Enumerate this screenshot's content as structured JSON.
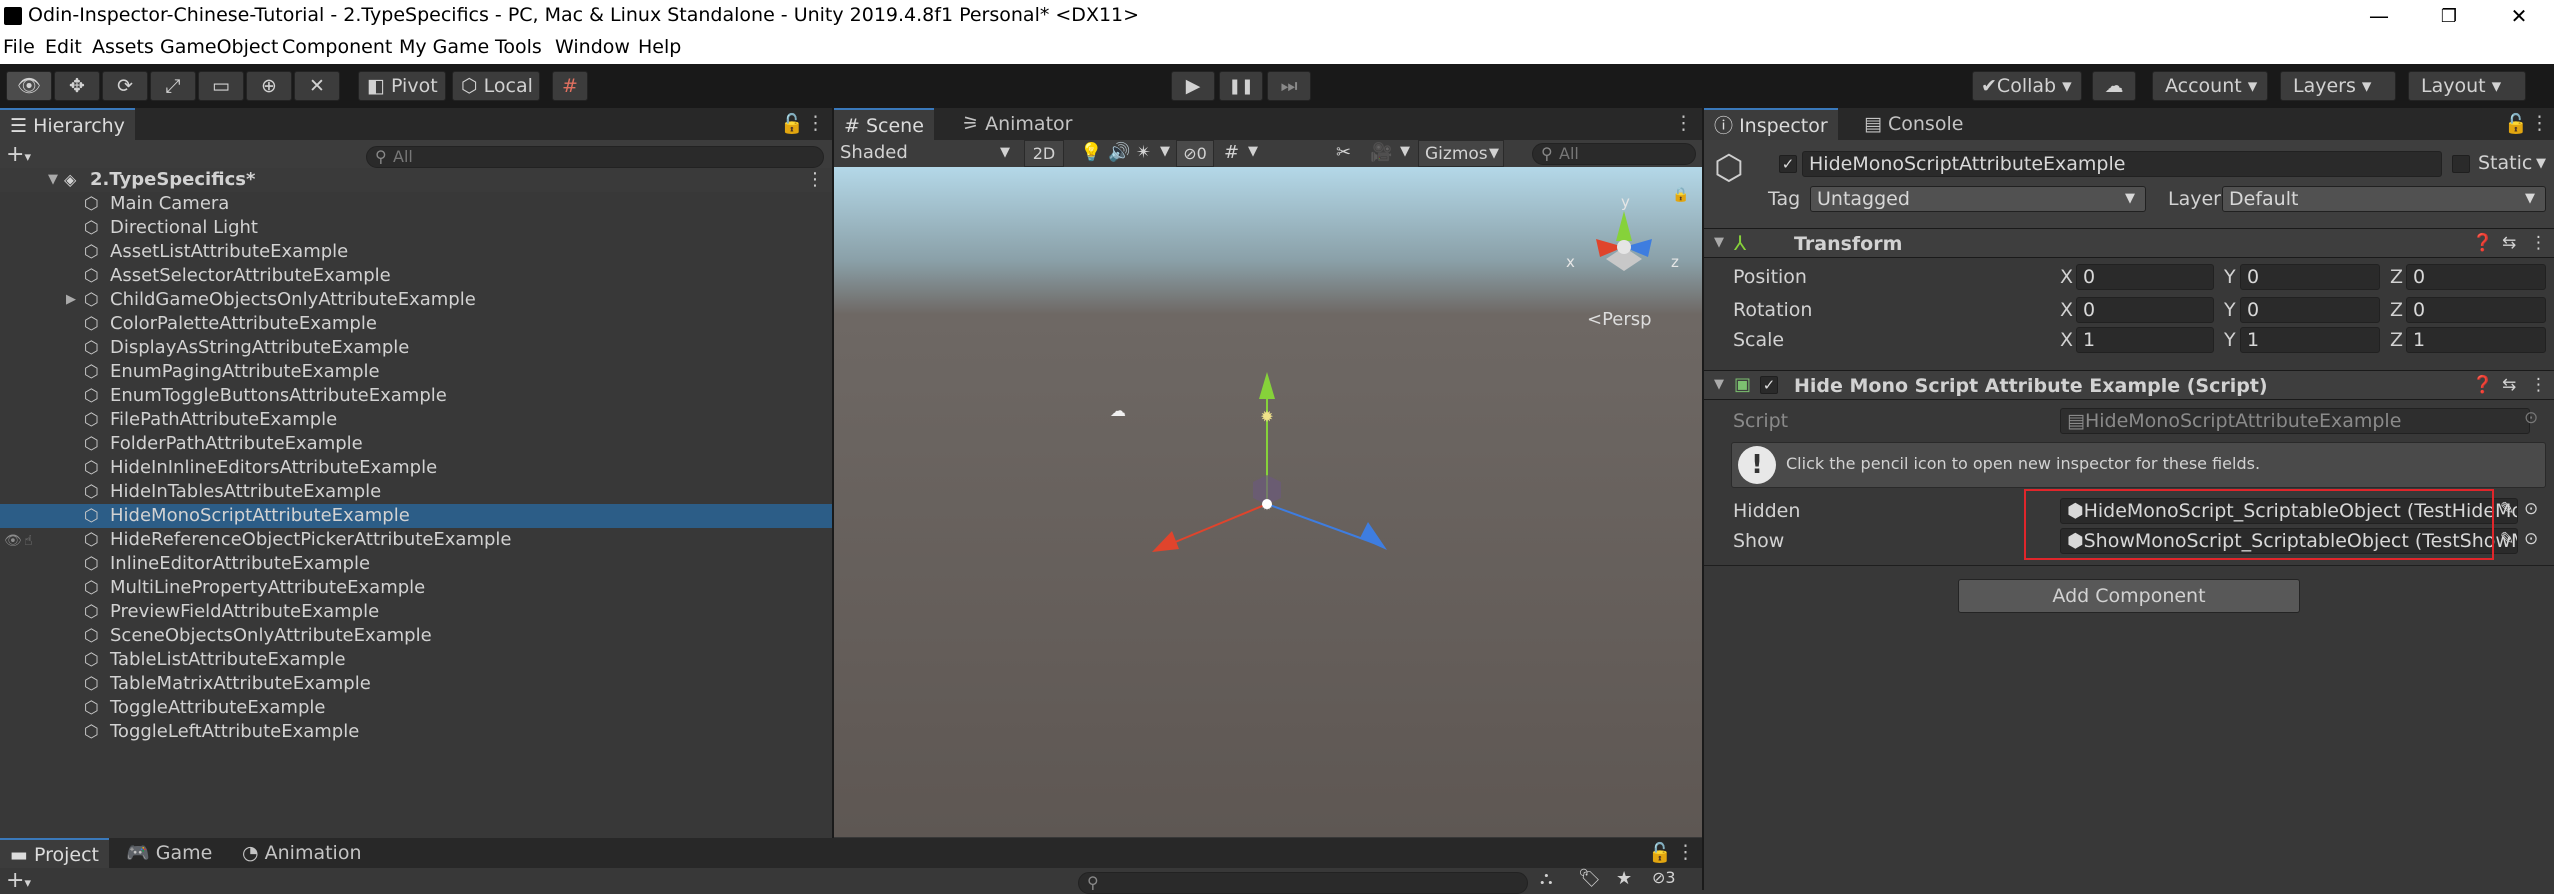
{
  "window": {
    "title": "Odin-Inspector-Chinese-Tutorial - 2.TypeSpecifics - PC, Mac & Linux Standalone - Unity 2019.4.8f1 Personal* <DX11>",
    "controls": {
      "minimize": "—",
      "maximize": "❐",
      "close": "✕"
    }
  },
  "menu": [
    "File",
    "Edit",
    "Assets",
    "GameObject",
    "Component",
    "My Game",
    "Tools",
    "Window",
    "Help"
  ],
  "toolbar": {
    "pivot": "Pivot",
    "local": "Local",
    "collab": "Collab",
    "account": "Account",
    "layers": "Layers",
    "layout": "Layout",
    "play_glyph": "▶",
    "pause_glyph": "❚❚",
    "step_glyph": "⏭"
  },
  "hierarchy": {
    "tab": "Hierarchy",
    "add": "+",
    "search_placeholder": "All",
    "scene_name": "2.TypeSpecifics*",
    "items": [
      {
        "label": "Main Camera",
        "expandable": false
      },
      {
        "label": "Directional Light",
        "expandable": false
      },
      {
        "label": "AssetListAttributeExample",
        "expandable": false
      },
      {
        "label": "AssetSelectorAttributeExample",
        "expandable": false
      },
      {
        "label": "ChildGameObjectsOnlyAttributeExample",
        "expandable": true
      },
      {
        "label": "ColorPaletteAttributeExample",
        "expandable": false
      },
      {
        "label": "DisplayAsStringAttributeExample",
        "expandable": false
      },
      {
        "label": "EnumPagingAttributeExample",
        "expandable": false
      },
      {
        "label": "EnumToggleButtonsAttributeExample",
        "expandable": false
      },
      {
        "label": "FilePathAttributeExample",
        "expandable": false
      },
      {
        "label": "FolderPathAttributeExample",
        "expandable": false
      },
      {
        "label": "HideInInlineEditorsAttributeExample",
        "expandable": false
      },
      {
        "label": "HideInTablesAttributeExample",
        "expandable": false
      },
      {
        "label": "HideMonoScriptAttributeExample",
        "expandable": false,
        "selected": true
      },
      {
        "label": "HideReferenceObjectPickerAttributeExample",
        "expandable": false
      },
      {
        "label": "InlineEditorAttributeExample",
        "expandable": false
      },
      {
        "label": "MultiLinePropertyAttributeExample",
        "expandable": false
      },
      {
        "label": "PreviewFieldAttributeExample",
        "expandable": false
      },
      {
        "label": "SceneObjectsOnlyAttributeExample",
        "expandable": false
      },
      {
        "label": "TableListAttributeExample",
        "expandable": false
      },
      {
        "label": "TableMatrixAttributeExample",
        "expandable": false
      },
      {
        "label": "ToggleAttributeExample",
        "expandable": false
      },
      {
        "label": "ToggleLeftAttributeExample",
        "expandable": false
      }
    ]
  },
  "scene": {
    "tabs": [
      "Scene",
      "Animator"
    ],
    "shading": "Shaded",
    "mode_2d": "2D",
    "hidden_count": "0",
    "gizmos": "Gizmos",
    "search_placeholder": "All",
    "persp": "<Persp",
    "axis_x": "x",
    "axis_y": "y",
    "axis_z": "z"
  },
  "inspector": {
    "tabs": [
      "Inspector",
      "Console"
    ],
    "object_name": "HideMonoScriptAttributeExample",
    "static_label": "Static",
    "tag_label": "Tag",
    "tag_value": "Untagged",
    "layer_label": "Layer",
    "layer_value": "Default",
    "transform": {
      "title": "Transform",
      "position": {
        "label": "Position",
        "x": "0",
        "y": "0",
        "z": "0"
      },
      "rotation": {
        "label": "Rotation",
        "x": "0",
        "y": "0",
        "z": "0"
      },
      "scale": {
        "label": "Scale",
        "x": "1",
        "y": "1",
        "z": "1"
      },
      "axis_x": "X",
      "axis_y": "Y",
      "axis_z": "Z"
    },
    "script_component": {
      "title": "Hide Mono Script Attribute Example (Script)",
      "script_label": "Script",
      "script_value": "HideMonoScriptAttributeExample",
      "info": "Click the pencil icon to open new inspector for these fields.",
      "hidden_label": "Hidden",
      "hidden_value": "HideMonoScript_ScriptableObject (TestHideMono",
      "show_label": "Show",
      "show_value": "ShowMonoScript_ScriptableObject (TestShowMor"
    },
    "add_component": "Add Component",
    "highlight_color": "#e0262b"
  },
  "project": {
    "tabs": [
      "Project",
      "Game",
      "Animation"
    ],
    "add": "+",
    "hidden_count": "3"
  },
  "colors": {
    "selection": "#2c5d87",
    "tab_accent": "#3a79bb",
    "gizmo_x": "#e0442c",
    "gizmo_y": "#86d23a",
    "gizmo_z": "#3e7de0"
  }
}
